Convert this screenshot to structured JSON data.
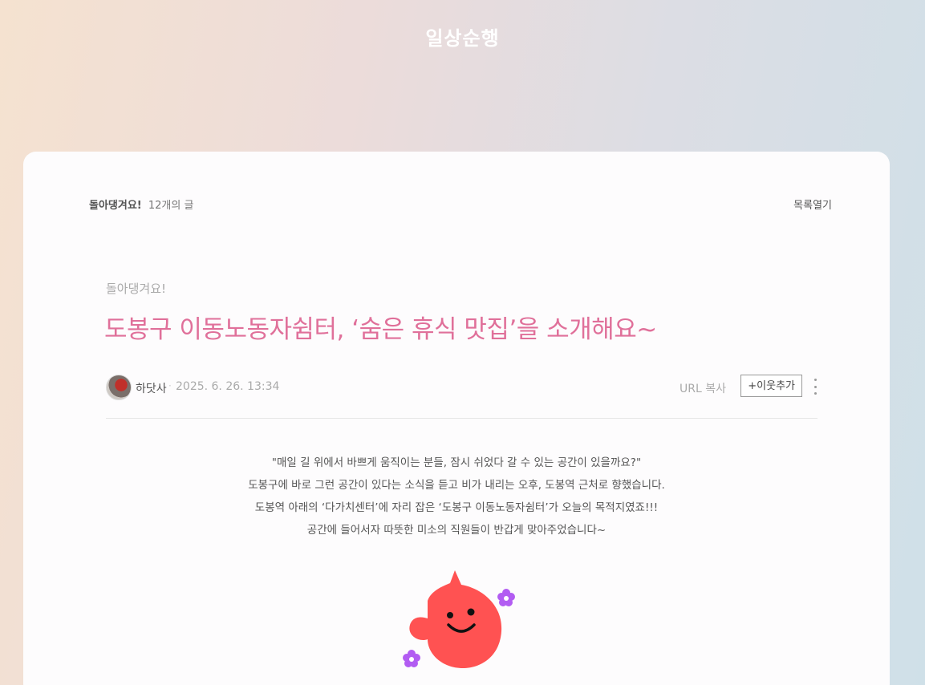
{
  "blog": {
    "title": "일상순행"
  },
  "list_header": {
    "category": "돌아댕겨요!",
    "count": "12개의 글",
    "toggle_label": "목록열기"
  },
  "post": {
    "category": "돌아댕겨요!",
    "title": "도봉구 이동노동자쉼터, ‘숨은 휴식 맛집’을 소개해요~",
    "author": "하닷사",
    "separator": "·",
    "date": "2025. 6. 26. 13:34",
    "url_copy_label": "URL 복사",
    "add_neighbor_label": "+이웃추가",
    "more_icon": "more-vertical-icon",
    "body_lines": [
      "\"매일 길 위에서 바쁘게 움직이는 분들, 잠시 쉬었다 갈 수 있는 공간이 있을까요?\"",
      "도봉구에 바로 그런 공간이 있다는 소식을 듣고 비가 내리는 오후, 도봉역 근처로 향했습니다.",
      "도봉역 아래의 ‘다가치센터’에 자리 잡은 ‘도봉구 이동노동자쉼터’가 오늘의 목적지였죠!!!",
      "공간에 들어서자 따뜻한 미소의 직원들이 반갑게 맞아주었습니다~"
    ],
    "sticker": "red-smiling-character-sticker"
  },
  "colors": {
    "title_accent": "#e0709a",
    "sticker_body": "#ff5252",
    "sticker_flower": "#b25cf2"
  }
}
